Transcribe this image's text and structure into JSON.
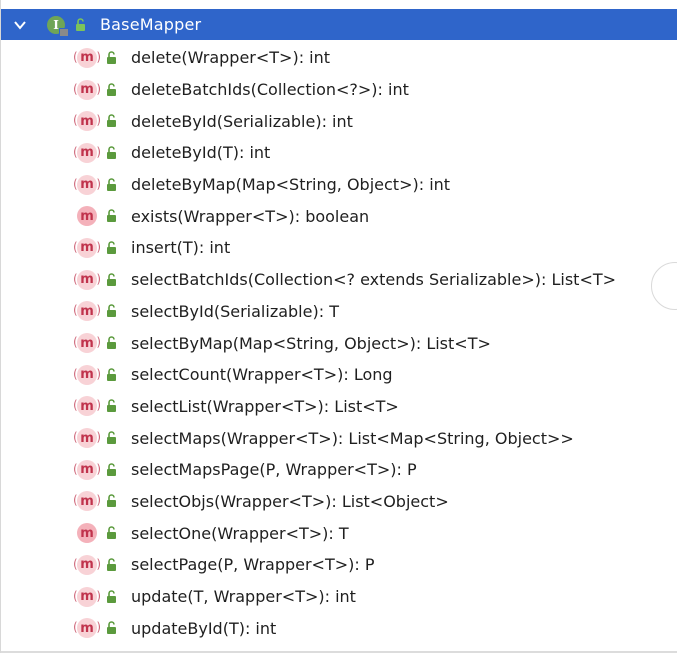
{
  "window": {
    "title": "BaseMapper"
  },
  "header": {
    "chevron_icon": "chevron-down-icon",
    "interface_icon": "interface-icon",
    "interface_glyph": "I",
    "lock_icon": "lock-open-icon",
    "title": "BaseMapper",
    "background": "#2f65ca"
  },
  "methods": [
    {
      "icon": "method-icon",
      "glyph": "m",
      "abstract": true,
      "signature": "delete(Wrapper<T>): int"
    },
    {
      "icon": "method-icon",
      "glyph": "m",
      "abstract": true,
      "signature": "deleteBatchIds(Collection<?>): int"
    },
    {
      "icon": "method-icon",
      "glyph": "m",
      "abstract": true,
      "signature": "deleteById(Serializable): int"
    },
    {
      "icon": "method-icon",
      "glyph": "m",
      "abstract": true,
      "signature": "deleteById(T): int"
    },
    {
      "icon": "method-icon",
      "glyph": "m",
      "abstract": true,
      "signature": "deleteByMap(Map<String, Object>): int"
    },
    {
      "icon": "method-icon",
      "glyph": "m",
      "abstract": false,
      "signature": "exists(Wrapper<T>): boolean"
    },
    {
      "icon": "method-icon",
      "glyph": "m",
      "abstract": true,
      "signature": "insert(T): int"
    },
    {
      "icon": "method-icon",
      "glyph": "m",
      "abstract": true,
      "signature": "selectBatchIds(Collection<? extends Serializable>): List<T>"
    },
    {
      "icon": "method-icon",
      "glyph": "m",
      "abstract": true,
      "signature": "selectById(Serializable): T"
    },
    {
      "icon": "method-icon",
      "glyph": "m",
      "abstract": true,
      "signature": "selectByMap(Map<String, Object>): List<T>"
    },
    {
      "icon": "method-icon",
      "glyph": "m",
      "abstract": true,
      "signature": "selectCount(Wrapper<T>): Long"
    },
    {
      "icon": "method-icon",
      "glyph": "m",
      "abstract": true,
      "signature": "selectList(Wrapper<T>): List<T>"
    },
    {
      "icon": "method-icon",
      "glyph": "m",
      "abstract": true,
      "signature": "selectMaps(Wrapper<T>): List<Map<String, Object>>"
    },
    {
      "icon": "method-icon",
      "glyph": "m",
      "abstract": true,
      "signature": "selectMapsPage(P, Wrapper<T>): P"
    },
    {
      "icon": "method-icon",
      "glyph": "m",
      "abstract": true,
      "signature": "selectObjs(Wrapper<T>): List<Object>"
    },
    {
      "icon": "method-icon",
      "glyph": "m",
      "abstract": false,
      "signature": "selectOne(Wrapper<T>): T"
    },
    {
      "icon": "method-icon",
      "glyph": "m",
      "abstract": true,
      "signature": "selectPage(P, Wrapper<T>): P"
    },
    {
      "icon": "method-icon",
      "glyph": "m",
      "abstract": true,
      "signature": "update(T, Wrapper<T>): int"
    },
    {
      "icon": "method-icon",
      "glyph": "m",
      "abstract": true,
      "signature": "updateById(T): int"
    }
  ],
  "colors": {
    "selection": "#2f65ca",
    "method_icon_bg": "#f8d2d6",
    "method_icon_text": "#c0334c",
    "interface_icon_bg": "#6fa557",
    "lock_green": "#5b9a3d"
  }
}
